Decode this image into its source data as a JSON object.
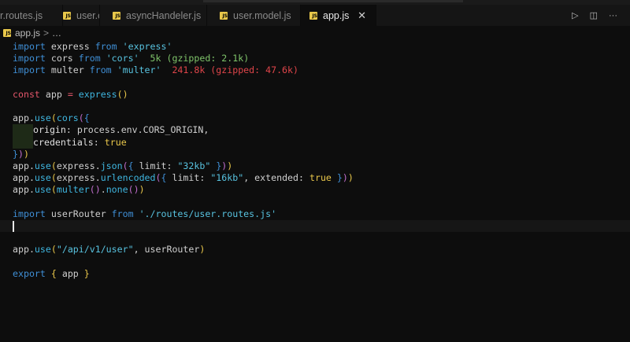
{
  "tabs": [
    {
      "label": "r.routes.js",
      "active": false
    },
    {
      "label": "user.controller.js",
      "active": false
    },
    {
      "label": "asyncHandeler.js",
      "active": false
    },
    {
      "label": "user.model.js",
      "active": false
    },
    {
      "label": "app.js",
      "active": true
    }
  ],
  "tab_badge": "JS",
  "tab_close": "✕",
  "actions": {
    "run": "▷",
    "split": "◫",
    "more": "···"
  },
  "breadcrumb": {
    "file": "app.js",
    "sep": ">",
    "rest": "…"
  },
  "code": {
    "l1": [
      "import",
      " express ",
      "from",
      " ",
      "'express'"
    ],
    "l2": [
      "import",
      " cors ",
      "from",
      " ",
      "'cors'",
      "  5k (gzipped: 2.1k)"
    ],
    "l3": [
      "import",
      " multer ",
      "from",
      " ",
      "'multer'",
      "  241.8k (gzipped: 47.6k)"
    ],
    "l5": [
      "const",
      " app ",
      "=",
      " ",
      "express",
      "()"
    ],
    "l7": [
      "app.",
      "use",
      "(",
      "cors",
      "(",
      "{"
    ],
    "l8": [
      "origin",
      ": process.env.CORS_ORIGIN,"
    ],
    "l9": [
      "credentials",
      ": ",
      "true"
    ],
    "l10": [
      "}",
      ")",
      ")"
    ],
    "l11": [
      "app.",
      "use",
      "(",
      "express.",
      "json",
      "(",
      "{",
      " limit: ",
      "\"32kb\"",
      " ",
      "}",
      ")",
      ")"
    ],
    "l12": [
      "app.",
      "use",
      "(",
      "express.",
      "urlencoded",
      "(",
      "{",
      " limit: ",
      "\"16kb\"",
      ", extended: ",
      "true",
      " ",
      "}",
      ")",
      ")"
    ],
    "l13": [
      "app.",
      "use",
      "(",
      "multer",
      "(",
      ")",
      ".",
      "none",
      "(",
      ")",
      ")"
    ],
    "l15": [
      "import",
      " userRouter ",
      "from",
      " ",
      "'./routes/user.routes.js'"
    ],
    "l18": [
      "app.",
      "use",
      "(",
      "\"/api/v1/user\"",
      ", userRouter",
      ")"
    ],
    "l20": [
      "export",
      " ",
      "{",
      " app ",
      "}"
    ]
  }
}
